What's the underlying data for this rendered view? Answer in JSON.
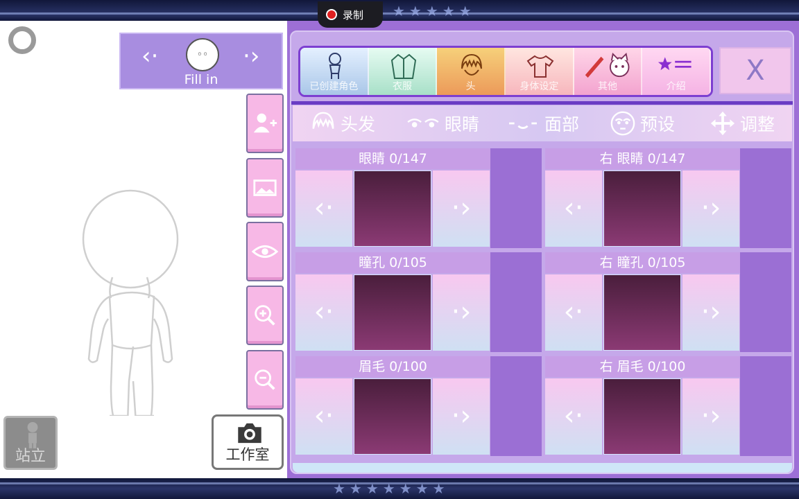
{
  "status": {
    "record_label": "录制"
  },
  "decor": {
    "top_stars": "★★★★★",
    "bottom_stars": "★★★★★★★"
  },
  "character": {
    "nav_prev": "‹·",
    "nav_next": "·›",
    "face_eyes": "◦◦",
    "label": "Fill in"
  },
  "left_buttons": {
    "stand_label": "站立",
    "studio_label": "工作室"
  },
  "categories": [
    {
      "label": "已创建角色"
    },
    {
      "label": "衣服"
    },
    {
      "label": "头"
    },
    {
      "label": "身体设定"
    },
    {
      "label": "其他"
    },
    {
      "label": "介绍"
    }
  ],
  "close_label": "X",
  "sub_tabs": [
    {
      "label": "头发",
      "icon": "hair-icon"
    },
    {
      "label": "眼睛",
      "icon": "eyes-icon"
    },
    {
      "label": "面部",
      "icon": "mouth-icon"
    },
    {
      "label": "预设",
      "icon": "face-preset-icon"
    },
    {
      "label": "调整",
      "icon": "move-icon"
    }
  ],
  "slots": [
    {
      "title": "眼睛 0/147"
    },
    {
      "title": "右 眼睛 0/147"
    },
    {
      "title": "瞳孔 0/105"
    },
    {
      "title": "右 瞳孔 0/105"
    },
    {
      "title": "眉毛 0/100"
    },
    {
      "title": "右 眉毛 0/100"
    }
  ],
  "slot_arrows": {
    "prev": "‹·",
    "next": "·›"
  },
  "colors": {
    "accent": "#9d6fd6",
    "swatch_top": "#4a1e3c",
    "swatch_bottom": "#8b3a74",
    "side_button": "#f7b8e6"
  }
}
